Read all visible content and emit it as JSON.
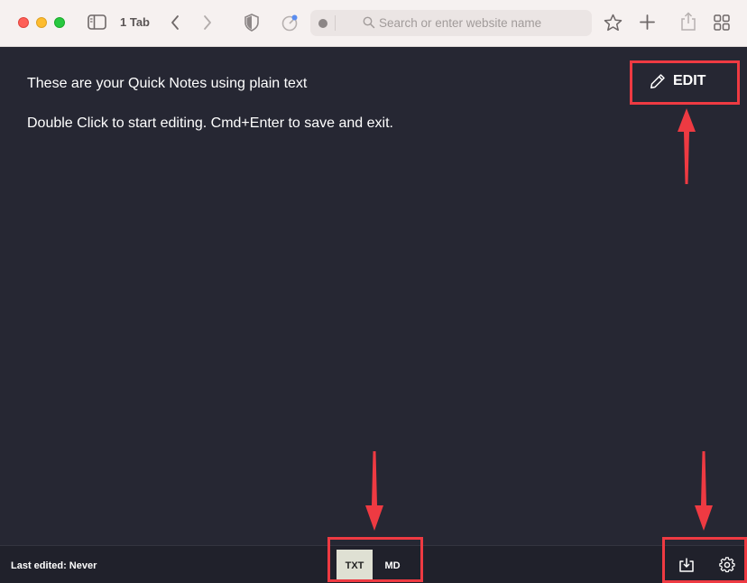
{
  "browser": {
    "tab_count_label": "1 Tab",
    "address_placeholder": "Search or enter website name"
  },
  "note": {
    "lines": [
      "These are your Quick Notes using plain text",
      "Double Click to start editing. Cmd+Enter to save and exit."
    ]
  },
  "edit_button": {
    "label": "EDIT"
  },
  "footer": {
    "last_edited": "Last edited: Never",
    "formats": [
      {
        "label": "TXT",
        "selected": true
      },
      {
        "label": "MD",
        "selected": false
      }
    ]
  },
  "colors": {
    "content_bg": "#262733",
    "footer_bg": "#20212b",
    "annotation_red": "#ee3a42",
    "selected_format_bg": "#dfe0d3"
  },
  "icons": [
    "sidebar-icon",
    "back-chevron-icon",
    "forward-chevron-icon",
    "shield-icon",
    "extension-icon",
    "search-icon",
    "star-icon",
    "plus-icon",
    "share-icon",
    "tab-overview-icon",
    "pencil-icon",
    "download-icon",
    "gear-icon"
  ]
}
